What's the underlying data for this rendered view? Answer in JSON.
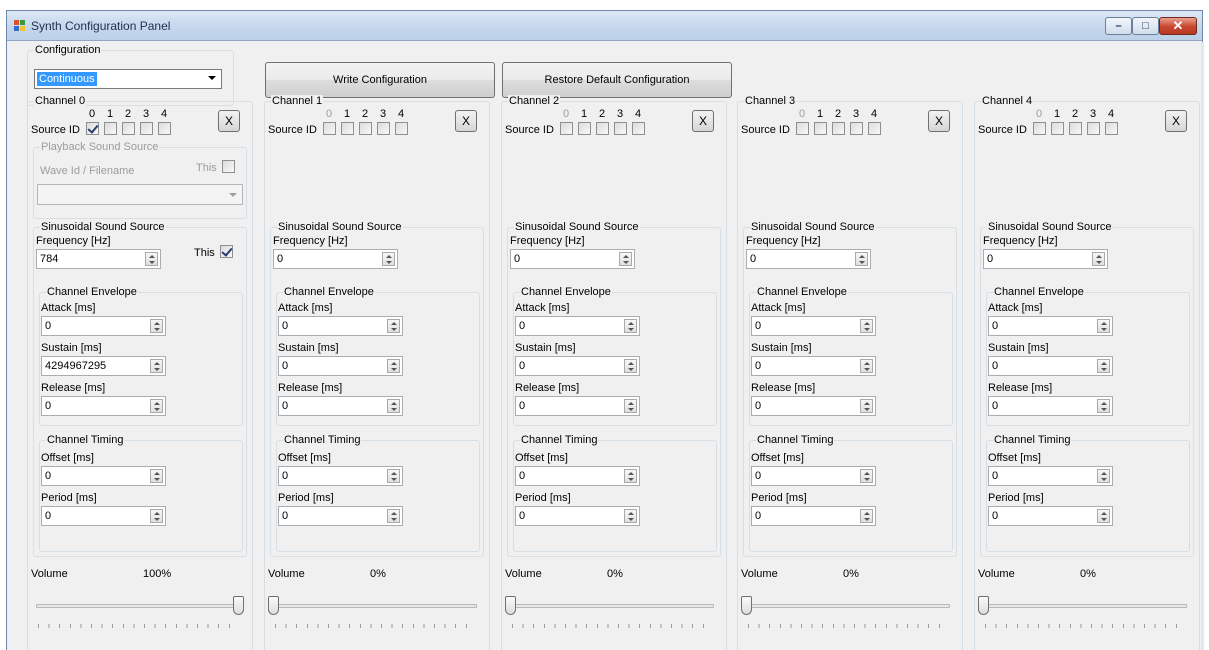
{
  "window": {
    "title": "Synth Configuration Panel",
    "controls": {
      "minimize": "–",
      "maximize": "□",
      "close": "✕"
    }
  },
  "configuration": {
    "group_title": "Configuration",
    "selected": "Continuous",
    "write_button": "Write Configuration",
    "restore_button": "Restore Default Configuration"
  },
  "labels": {
    "source_id": "Source ID",
    "source_ids": [
      "0",
      "1",
      "2",
      "3",
      "4"
    ],
    "remove": "X",
    "playback_group": "Playback Sound Source",
    "wave_id": "Wave Id / Filename",
    "this": "This",
    "sinusoidal_group": "Sinusoidal Sound Source",
    "frequency": "Frequency [Hz]",
    "envelope_group": "Channel Envelope",
    "attack": "Attack [ms]",
    "sustain": "Sustain [ms]",
    "release": "Release [ms]",
    "timing_group": "Channel Timing",
    "offset": "Offset [ms]",
    "period": "Period [ms]",
    "volume": "Volume"
  },
  "channels": [
    {
      "name": "Channel 0",
      "source_checked": [
        true,
        false,
        false,
        false,
        false
      ],
      "playback_this_checked": false,
      "sine_this_checked": true,
      "frequency": "784",
      "attack": "0",
      "sustain": "4294967295",
      "release": "0",
      "offset": "0",
      "period": "0",
      "volume_text": "100%",
      "volume": 1.0
    },
    {
      "name": "Channel 1",
      "source_checked": [
        false,
        false,
        false,
        false,
        false
      ],
      "frequency": "0",
      "attack": "0",
      "sustain": "0",
      "release": "0",
      "offset": "0",
      "period": "0",
      "volume_text": "0%",
      "volume": 0.0
    },
    {
      "name": "Channel 2",
      "source_checked": [
        false,
        false,
        false,
        false,
        false
      ],
      "frequency": "0",
      "attack": "0",
      "sustain": "0",
      "release": "0",
      "offset": "0",
      "period": "0",
      "volume_text": "0%",
      "volume": 0.0
    },
    {
      "name": "Channel 3",
      "source_checked": [
        false,
        false,
        false,
        false,
        false
      ],
      "frequency": "0",
      "attack": "0",
      "sustain": "0",
      "release": "0",
      "offset": "0",
      "period": "0",
      "volume_text": "0%",
      "volume": 0.0
    },
    {
      "name": "Channel 4",
      "source_checked": [
        false,
        false,
        false,
        false,
        false
      ],
      "frequency": "0",
      "attack": "0",
      "sustain": "0",
      "release": "0",
      "offset": "0",
      "period": "0",
      "volume_text": "0%",
      "volume": 0.0
    }
  ],
  "colors": {
    "selection": "#3399ff",
    "close_button": "#c8462e",
    "titlebar": "#c3d6ec"
  }
}
